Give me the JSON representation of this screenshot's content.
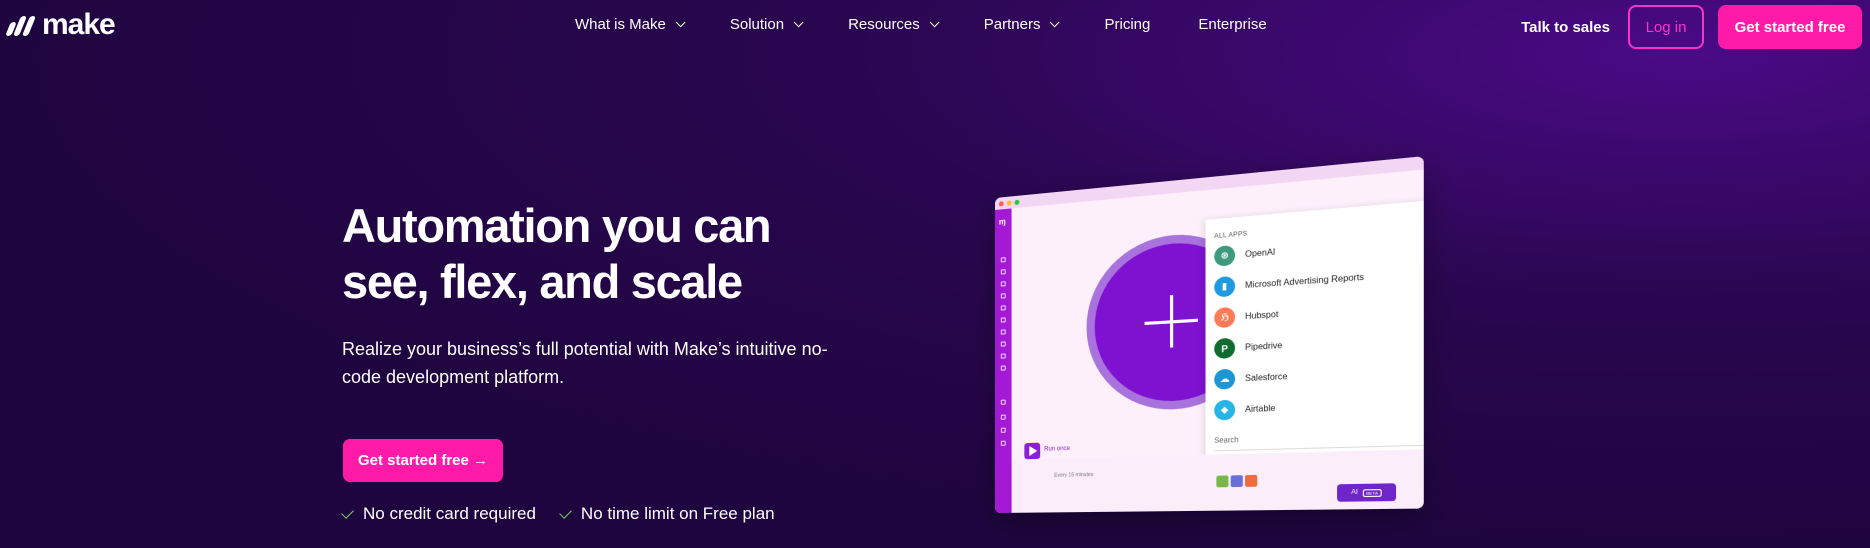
{
  "nav": {
    "logo_text": "make",
    "menu": [
      {
        "label": "What is Make",
        "dropdown": true
      },
      {
        "label": "Solution",
        "dropdown": true
      },
      {
        "label": "Resources",
        "dropdown": true
      },
      {
        "label": "Partners",
        "dropdown": true
      },
      {
        "label": "Pricing",
        "dropdown": false
      },
      {
        "label": "Enterprise",
        "dropdown": false
      }
    ],
    "talk_to_sales": "Talk to sales",
    "log_in": "Log in",
    "get_started": "Get started free"
  },
  "hero": {
    "title": "Automation you can see, flex, and scale",
    "subtitle": "Realize your business’s full potential with Make’s intuitive no-code development platform.",
    "cta": "Get started free →",
    "checks": [
      "No credit card required",
      "No time limit on Free plan"
    ]
  },
  "illustration": {
    "panel_heading": "ALL APPS",
    "apps": [
      {
        "name": "OpenAI",
        "color": "#3d9a7d",
        "glyph": "⊛"
      },
      {
        "name": "Microsoft Advertising Reports",
        "color": "#1d9be0",
        "glyph": "▮"
      },
      {
        "name": "Hubspot",
        "color": "#ff7a59",
        "glyph": "ℌ"
      },
      {
        "name": "Pipedrive",
        "color": "#0f6b2e",
        "glyph": "P"
      },
      {
        "name": "Salesforce",
        "color": "#1b96d6",
        "glyph": "☁"
      },
      {
        "name": "Airtable",
        "color": "#27b5e8",
        "glyph": "◆"
      }
    ],
    "search_label": "Search",
    "run_label": "Run once",
    "schedule_label": "Every 15 minutes",
    "ai_label": "AI",
    "ai_badge": "BETA"
  },
  "colors": {
    "accent": "#ff1ba8",
    "login_border": "#ff30c8",
    "bg": "#2a0650",
    "check": "#7ad05a",
    "circle": "#7f12d0"
  }
}
